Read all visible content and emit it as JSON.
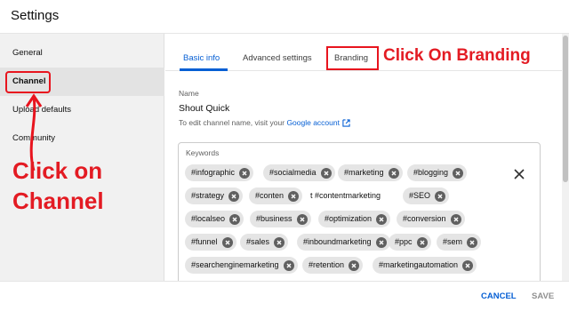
{
  "header": {
    "title": "Settings"
  },
  "sidebar": {
    "items": [
      {
        "label": "General"
      },
      {
        "label": "Channel"
      },
      {
        "label": "Upload defaults"
      },
      {
        "label": "Community"
      }
    ]
  },
  "annotations": {
    "channel": "Click on Channel",
    "branding": "Click On Branding"
  },
  "tabs": [
    {
      "label": "Basic info"
    },
    {
      "label": "Advanced settings"
    },
    {
      "label": "Branding"
    }
  ],
  "name_section": {
    "label": "Name",
    "value": "Shout Quick",
    "hint": "To edit channel name, visit your ",
    "hint_link": "Google account"
  },
  "keywords": {
    "label": "Keywords",
    "chips": [
      "#infographic",
      "#socialmedia",
      "#marketing",
      "#blogging",
      "#strategy",
      "#conten",
      "t #contentmarketing",
      "#SEO",
      "#localseo",
      "#business",
      "#optimization",
      "#conversion",
      "#funnel",
      "#sales",
      "#inboundmarketing",
      "#ppc",
      "#sem",
      "#searchenginemarketing",
      "#retention",
      "#marketingautomation"
    ]
  },
  "footer": {
    "cancel_label": "CANCEL",
    "save_label": "SAVE"
  },
  "colors": {
    "accent": "#065fd4",
    "annotation": "#e31b23"
  }
}
